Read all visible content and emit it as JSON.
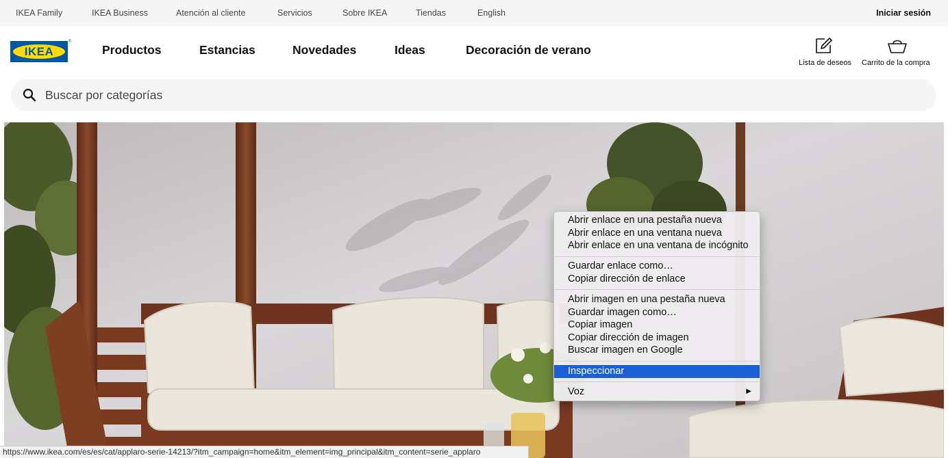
{
  "topbar": {
    "links": [
      "IKEA Family",
      "IKEA Business",
      "Atención al cliente",
      "Servicios",
      "Sobre IKEA",
      "Tiendas",
      "English"
    ],
    "login": "Iniciar sesión"
  },
  "header": {
    "logo_text": "IKEA",
    "nav": [
      "Productos",
      "Estancias",
      "Novedades",
      "Ideas",
      "Decoración de verano"
    ],
    "wishlist_label": "Lista de deseos",
    "cart_label": "Carrito de la compra"
  },
  "search": {
    "placeholder": "Buscar por categorías"
  },
  "context_menu": {
    "items": [
      "Abrir enlace en una pestaña nueva",
      "Abrir enlace en una ventana nueva",
      "Abrir enlace en una ventana de incógnito",
      "Guardar enlace como…",
      "Copiar dirección de enlace",
      "Abrir imagen en una pestaña nueva",
      "Guardar imagen como…",
      "Copiar imagen",
      "Copiar dirección de imagen",
      "Buscar imagen en Google",
      "Inspeccionar",
      "Voz"
    ],
    "highlighted": "Inspeccionar",
    "highlight_color": "#1b5fd6"
  },
  "status_bar": {
    "url": "https://www.ikea.com/es/es/cat/applaro-serie-14213/?itm_campaign=home&itm_element=img_principal&itm_content=serie_applaro"
  },
  "colors": {
    "brand_blue": "#0058a3",
    "brand_yellow": "#ffdb00"
  }
}
